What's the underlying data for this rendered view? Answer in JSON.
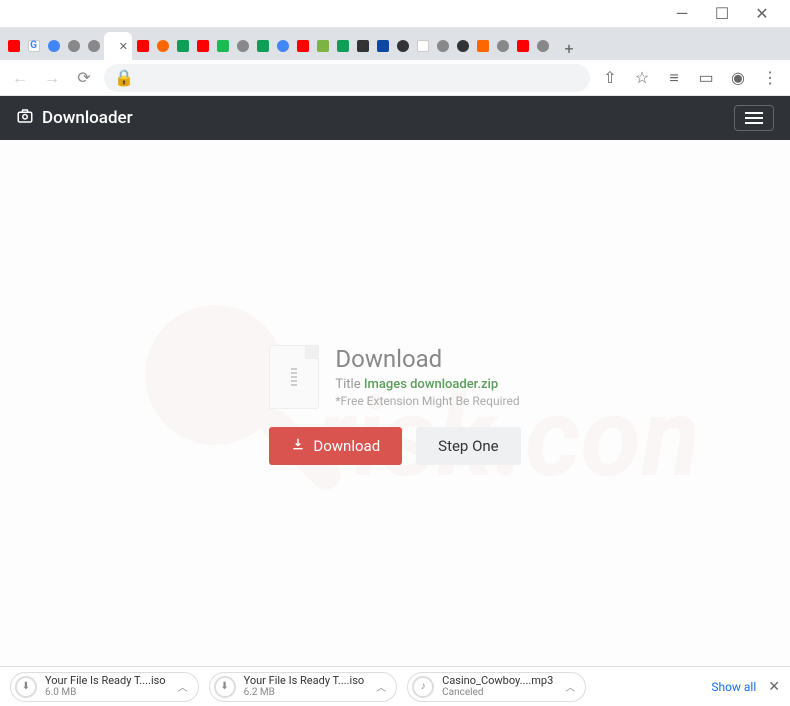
{
  "window": {
    "minimize": "—",
    "maximize": "☐",
    "close": "✕"
  },
  "tabs": {
    "new_tab": "+"
  },
  "nav": {
    "back": "←",
    "forward": "→",
    "reload": "⟳"
  },
  "toolbar": {
    "share": "⇧",
    "star": "☆",
    "reading": "≡",
    "ext": "▭",
    "profile": "◉",
    "menu": "⋮"
  },
  "header": {
    "brand": "Downloader"
  },
  "content": {
    "heading": "Download",
    "title_label": "Title",
    "filename": "Images downloader.zip",
    "note": "*Free Extension Might Be Required",
    "download_btn": "Download",
    "step_btn": "Step One"
  },
  "downloads_bar": {
    "items": [
      {
        "name": "Your File Is Ready T....iso",
        "size": "6.0 MB"
      },
      {
        "name": "Your File Is Ready T....iso",
        "size": "6.2 MB"
      },
      {
        "name": "Casino_Cowboy....mp3",
        "size": "Canceled"
      }
    ],
    "show_all": "Show all",
    "close": "✕"
  }
}
